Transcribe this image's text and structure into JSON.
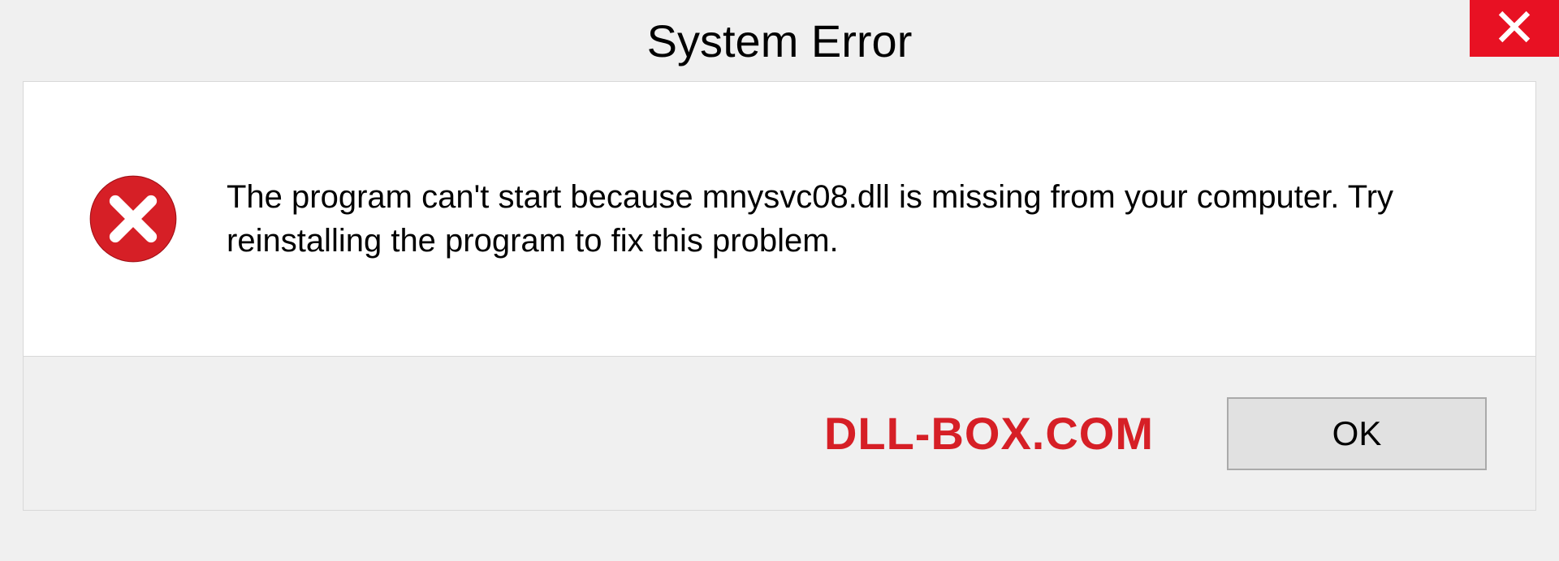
{
  "titlebar": {
    "title": "System Error"
  },
  "dialog": {
    "message": "The program can't start because mnysvc08.dll is missing from your computer. Try reinstalling the program to fix this problem."
  },
  "footer": {
    "watermark": "DLL-BOX.COM",
    "ok_label": "OK"
  },
  "icons": {
    "close": "close-icon",
    "error": "error-circle-x-icon"
  },
  "colors": {
    "close_bg": "#e81123",
    "error_fill": "#d61f26",
    "watermark": "#d61f26"
  }
}
